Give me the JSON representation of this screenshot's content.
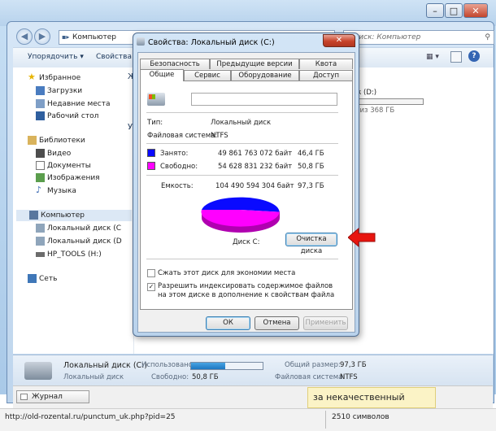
{
  "explorer": {
    "address": "Компьютер",
    "search_placeholder": "Поиск: Компьютер",
    "toolbar": {
      "organize": "Упорядочить",
      "properties": "Свойства"
    },
    "sidebar": {
      "favorites": "Избранное",
      "downloads": "Загрузки",
      "recent": "Недавние места",
      "desktop": "Рабочий стол",
      "libraries": "Библиотеки",
      "video": "Видео",
      "documents": "Документы",
      "images": "Изображения",
      "music": "Музыка",
      "computer": "Компьютер",
      "local_c": "Локальный диск (С",
      "local_d": "Локальный диск (D",
      "hp_tools": "HP_TOOLS (H:)",
      "network": "Сеть"
    },
    "content": {
      "disk_d_label": "иск (D:)",
      "disk_d_free": "он из 368 ГБ",
      "collapsed_ж": "Ж",
      "collapsed_у": "У"
    },
    "statusbar": {
      "drive_name": "Локальный диск (С:)",
      "used_label": "Использовано:",
      "drive_type": "Локальный диск",
      "free_label": "Свободно:",
      "free_value": "50,8 ГБ",
      "total_label": "Общий размер:",
      "total_value": "97,3 ГБ",
      "fs_label": "Файловая система:",
      "fs_value": "NTFS"
    }
  },
  "browser": {
    "journal": "Журнал",
    "ad_text": "за некачественный материал",
    "url": "http://old-rozental.ru/punctum_uk.php?pid=25",
    "chars": "2510 символов"
  },
  "dialog": {
    "title": "Свойства: Локальный диск (С:)",
    "tabs_row1": [
      "Безопасность",
      "Предыдущие версии",
      "Квота"
    ],
    "tabs_row2": [
      "Общие",
      "Сервис",
      "Оборудование",
      "Доступ"
    ],
    "name_value": "",
    "type_label": "Тип:",
    "type_value": "Локальный диск",
    "fs_label": "Файловая система:",
    "fs_value": "NTFS",
    "used_label": "Занято:",
    "used_bytes": "49 861 763 072 байт",
    "used_gb": "46,4 ГБ",
    "free_label": "Свободно:",
    "free_bytes": "54 628 831 232 байт",
    "free_gb": "50,8 ГБ",
    "capacity_label": "Емкость:",
    "capacity_bytes": "104 490 594 304 байт",
    "capacity_gb": "97,3 ГБ",
    "disk_label": "Диск С:",
    "cleanup_button": "Очистка диска",
    "compress_label": "Сжать этот диск для экономии места",
    "index_label": "Разрешить индексировать содержимое файлов на этом диске в дополнение к свойствам файла",
    "ok": "ОК",
    "cancel": "Отмена",
    "apply": "Применить",
    "used_fraction": 0.477,
    "used_color": "#0a0aff",
    "free_color": "#ff00ff"
  }
}
